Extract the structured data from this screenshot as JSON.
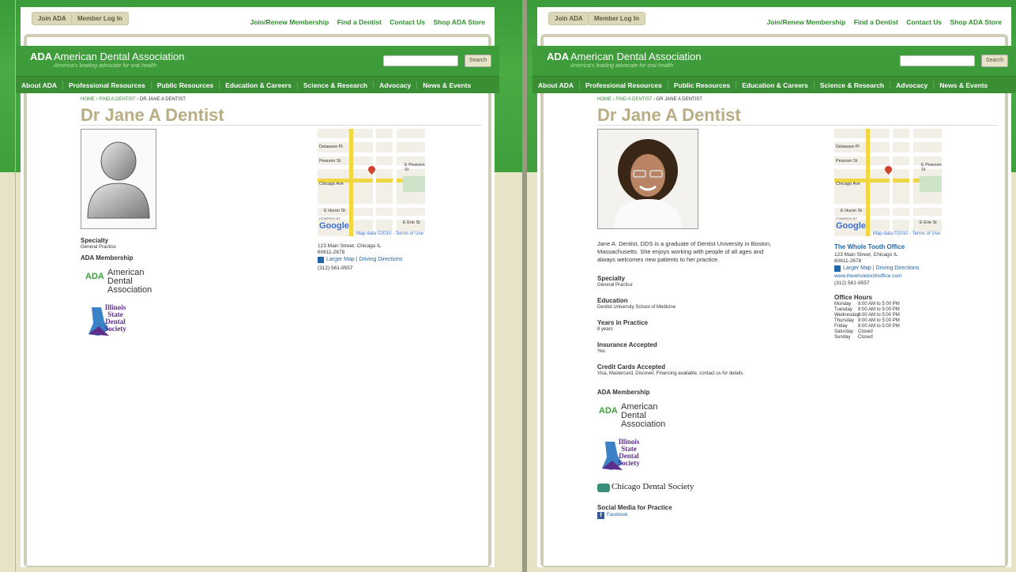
{
  "global": {
    "join_btn": "Join ADA",
    "login_btn": "Member Log In",
    "top_links": [
      "Join/Renew Membership",
      "Find a Dentist",
      "Contact Us",
      "Shop ADA Store"
    ],
    "brand_ada": "ADA",
    "brand_name": "American Dental Association",
    "brand_tag": "America's leading advocate for oral health",
    "search_btn": "Search",
    "nav": [
      "About ADA",
      "Professional Resources",
      "Public Resources",
      "Education & Careers",
      "Science & Research",
      "Advocacy",
      "News & Events"
    ]
  },
  "left": {
    "breadcrumb": [
      "HOME",
      "FIND A DENTIST",
      "DR JANE A DENTIST"
    ],
    "title": "Dr Jane A Dentist",
    "specialty_label": "Specialty",
    "specialty_val": "General Practice",
    "membership_label": "ADA Membership",
    "ada_logo_ada": "ADA",
    "ada_logo_lines": [
      "American",
      "Dental",
      "Association"
    ],
    "isds_lines": [
      "Illinois",
      "State",
      "Dental",
      "Society"
    ],
    "address1": "123 Main Street, Chicago IL",
    "address2": "60611-2678",
    "map_links": "Larger Map | Driving Directions",
    "phone": "(312) 561-9557"
  },
  "right": {
    "breadcrumb": [
      "HOME",
      "FIND A DENTIST",
      "DR JANE A DENTIST"
    ],
    "title": "Dr Jane A Dentist",
    "bio": "Jane A. Dentist, DDS is a graduate of Dentist University in Boston, Massachusetts. She enjoys working with people of all ages and always welcomes new patients to her practice.",
    "specialty_label": "Specialty",
    "specialty_val": "General Practice",
    "education_label": "Education",
    "education_val": "Dentist University School of Medicine",
    "years_label": "Years in Practice",
    "years_val": "8 years",
    "insurance_label": "Insurance Accepted",
    "insurance_val": "Yes",
    "cards_label": "Credit Cards Accepted",
    "cards_val": "Visa, Mastercard, Discover, Financing available; contact us for details.",
    "membership_label": "ADA Membership",
    "ada_logo_ada": "ADA",
    "ada_logo_lines": [
      "American",
      "Dental",
      "Association"
    ],
    "isds_lines": [
      "Illinois",
      "State",
      "Dental",
      "Society"
    ],
    "cds_name": "Chicago Dental Society",
    "social_label": "Social Media for Practice",
    "facebook": "Facebook",
    "office_name": "The Whole Tooth Office",
    "address1": "123 Main Street, Chicago IL",
    "address2": "60611-2678",
    "map_links": "Larger Map | Driving Directions",
    "website": "www.thewholetoothoffice.com",
    "phone": "(312) 561-9557",
    "hours_label": "Office Hours",
    "hours": [
      {
        "day": "Monday",
        "time": "8:00 AM to 5:00 PM"
      },
      {
        "day": "Tuesday",
        "time": "8:00 AM to 5:00 PM"
      },
      {
        "day": "Wednesday",
        "time": "8:00 AM to 5:00 PM"
      },
      {
        "day": "Thursday",
        "time": "8:00 AM to 5:00 PM"
      },
      {
        "day": "Friday",
        "time": "8:00 AM to 5:00 PM"
      },
      {
        "day": "Saturday",
        "time": "Closed"
      },
      {
        "day": "Sunday",
        "time": "Closed"
      }
    ]
  },
  "map": {
    "streets": [
      "Delaware Pl",
      "Chestnut St",
      "Pearson St",
      "E Pearson St",
      "Chicago Ave",
      "E Huron St",
      "E Erie St",
      "N Dewitt Pl",
      "N Fairbanks Ct",
      "Streeterville"
    ],
    "poi": "Northwestern University and Law",
    "powered": "POWERED BY",
    "google": "Google",
    "data": "Map data ©2010 - Terms of Use"
  }
}
